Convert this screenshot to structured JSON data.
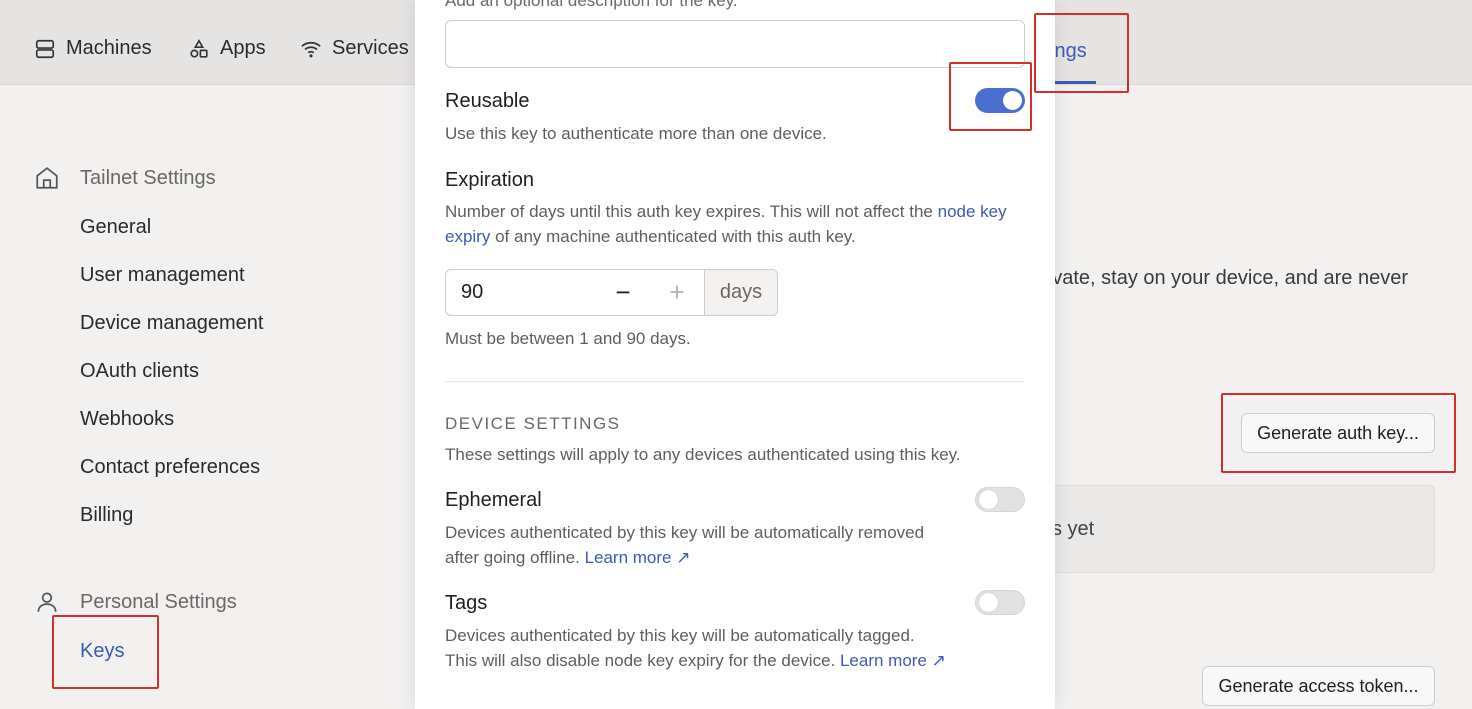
{
  "nav": {
    "machines": "Machines",
    "apps": "Apps",
    "services": "Services",
    "settings_partial": "ings"
  },
  "sidebar": {
    "tailnet_heading": "Tailnet Settings",
    "tailnet_items": [
      "General",
      "User management",
      "Device management",
      "OAuth clients",
      "Webhooks",
      "Contact preferences",
      "Billing"
    ],
    "personal_heading": "Personal Settings",
    "personal_items": [
      "Keys"
    ]
  },
  "background": {
    "partial_text": "private, stay on your device, and are never",
    "generate_auth_key": "Generate auth key...",
    "empty_partial": "s yet",
    "generate_access_token": "Generate access token..."
  },
  "modal": {
    "description_help": "Add an optional description for the key.",
    "description_value": "",
    "reusable": {
      "label": "Reusable",
      "help": "Use this key to authenticate more than one device.",
      "enabled": true
    },
    "expiration": {
      "label": "Expiration",
      "help_before": "Number of days until this auth key expires. This will not affect the ",
      "help_link": "node key expiry",
      "help_after": " of any machine authenticated with this auth key.",
      "value": "90",
      "minus": "−",
      "plus": "+",
      "unit": "days",
      "constraint": "Must be between 1 and 90 days."
    },
    "device_settings": {
      "title": "DEVICE SETTINGS",
      "help": "These settings will apply to any devices authenticated using this key."
    },
    "ephemeral": {
      "label": "Ephemeral",
      "help_line1": "Devices authenticated by this key will be automatically removed",
      "help_line2": "after going offline. ",
      "learn_more": "Learn more ↗",
      "enabled": false
    },
    "tags": {
      "label": "Tags",
      "help_line1": "Devices authenticated by this key will be automatically tagged.",
      "help_line2": "This will also disable node key expiry for the device. ",
      "learn_more": "Learn more ↗",
      "enabled": false
    }
  },
  "colors": {
    "accent": "#3b5bb5",
    "toggle_on": "#4a6ed1",
    "annotation": "#d32f2f"
  }
}
